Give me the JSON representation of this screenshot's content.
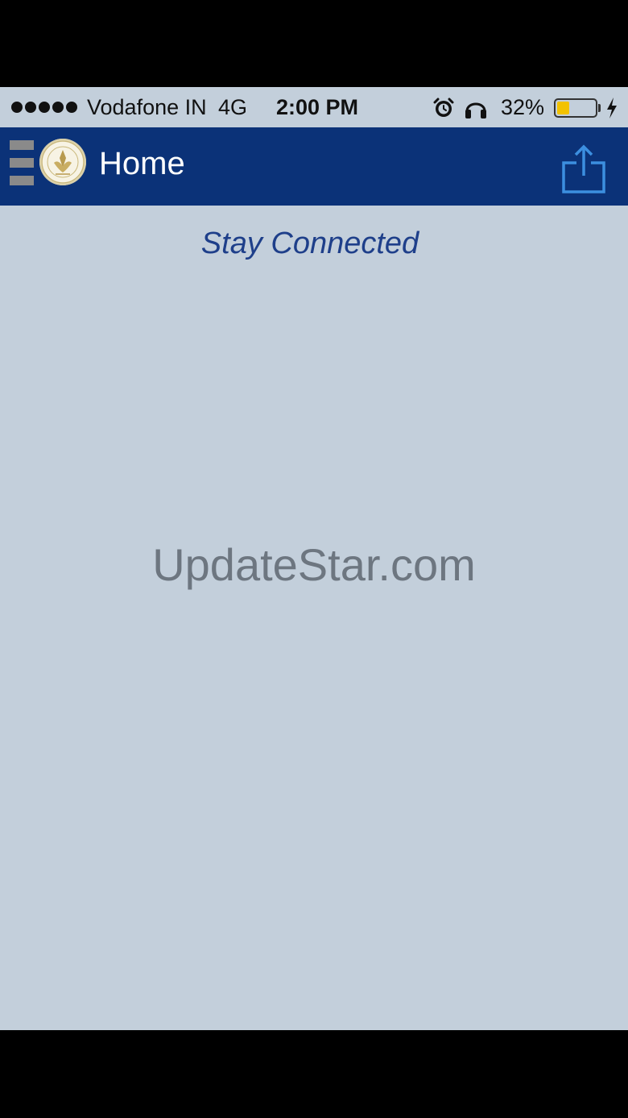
{
  "status_bar": {
    "carrier": "Vodafone IN",
    "network": "4G",
    "time": "2:00 PM",
    "battery_percent_label": "32%",
    "battery_level": 0.32,
    "battery_color": "#f2c200",
    "icons": [
      "signal-dots-icon",
      "alarm-icon",
      "headphones-icon",
      "battery-icon",
      "charging-bolt-icon"
    ]
  },
  "nav_bar": {
    "title": "Home",
    "background_color": "#0b3278",
    "icons": [
      "hamburger-menu-icon",
      "app-logo-seal",
      "share-icon"
    ]
  },
  "content": {
    "subtitle": "Stay Connected",
    "subtitle_color": "#1e3f8a",
    "watermark": "UpdateStar.com",
    "background_color": "#c3cfdb"
  }
}
